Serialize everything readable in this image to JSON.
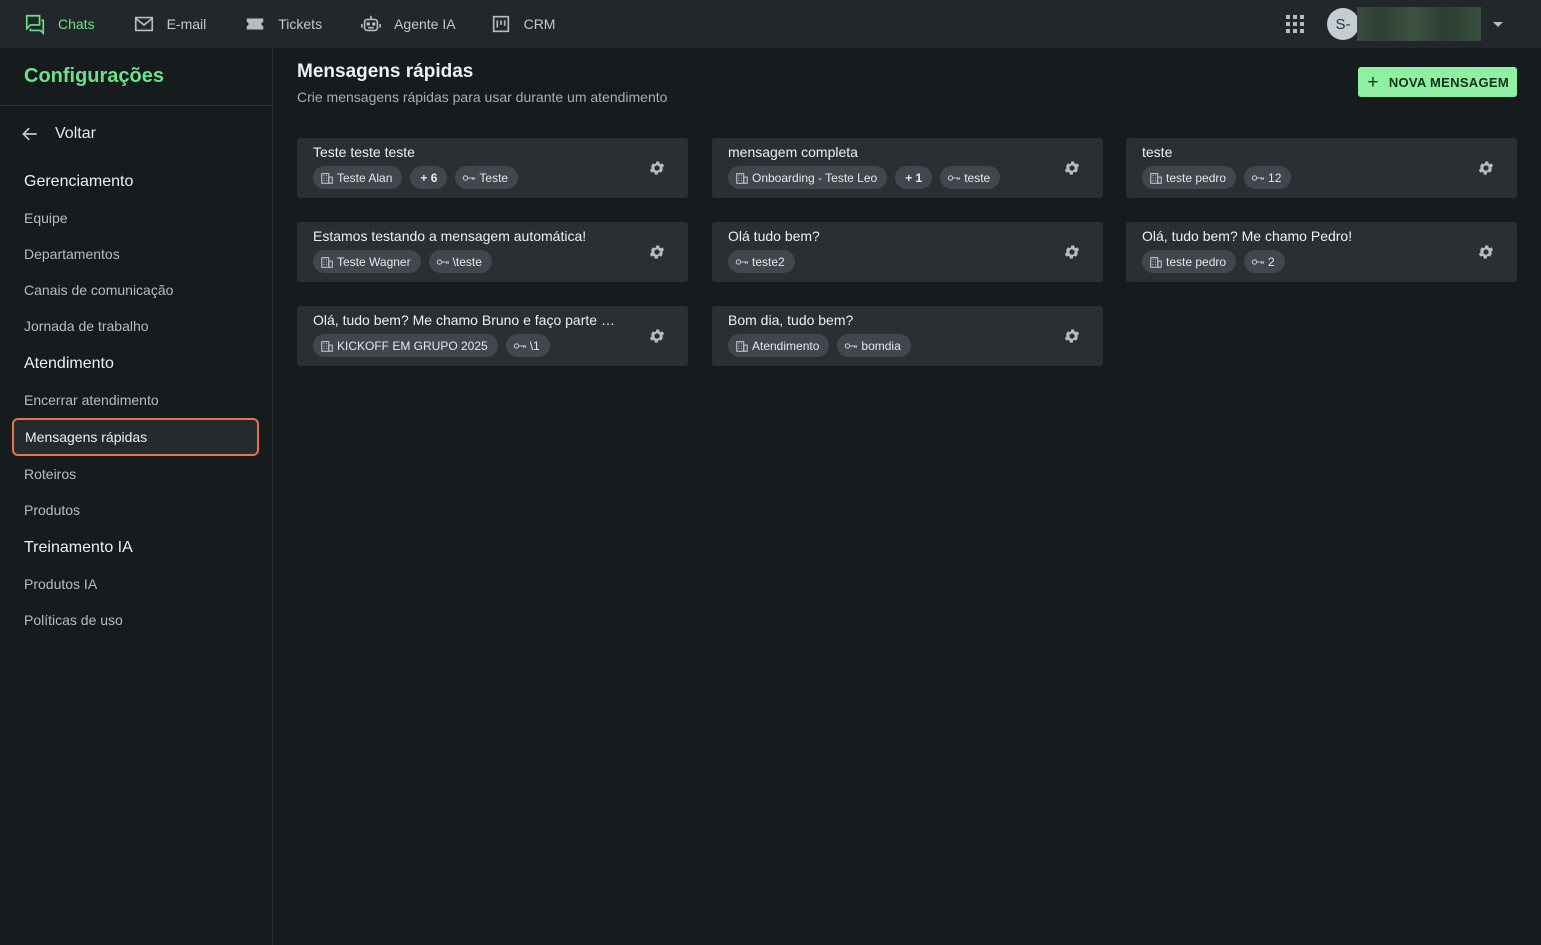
{
  "topnav": {
    "items": [
      {
        "label": "Chats",
        "icon": "chat-icon"
      },
      {
        "label": "E-mail",
        "icon": "mail-icon"
      },
      {
        "label": "Tickets",
        "icon": "ticket-icon"
      },
      {
        "label": "Agente IA",
        "icon": "robot-icon"
      },
      {
        "label": "CRM",
        "icon": "kanban-icon"
      }
    ],
    "avatar_initial": "S-"
  },
  "sidebar": {
    "title": "Configurações",
    "back_label": "Voltar",
    "sections": [
      {
        "title": "Gerenciamento",
        "items": [
          "Equipe",
          "Departamentos",
          "Canais de comunicação",
          "Jornada de trabalho"
        ]
      },
      {
        "title": "Atendimento",
        "items": [
          "Encerrar atendimento",
          "Mensagens rápidas",
          "Roteiros",
          "Produtos"
        ]
      },
      {
        "title": "Treinamento IA",
        "items": [
          "Produtos IA",
          "Políticas de uso"
        ]
      }
    ],
    "selected": "Mensagens rápidas"
  },
  "main": {
    "title": "Mensagens rápidas",
    "subtitle": "Crie mensagens rápidas para usar durante um atendimento",
    "new_button": "NOVA MENSAGEM",
    "cards": [
      {
        "title": "Teste teste teste",
        "department": "Teste Alan",
        "extra": "+ 6",
        "shortcut": "Teste"
      },
      {
        "title": "mensagem completa",
        "department": "Onboarding - Teste Leo",
        "extra": "+ 1",
        "shortcut": "teste"
      },
      {
        "title": "teste",
        "department": "teste pedro",
        "extra": "",
        "shortcut": "12"
      },
      {
        "title": "Estamos testando a mensagem automática!",
        "department": "Teste Wagner",
        "extra": "",
        "shortcut": "\\teste"
      },
      {
        "title": "Olá tudo bem?",
        "department": "",
        "extra": "",
        "shortcut": "teste2"
      },
      {
        "title": "Olá, tudo bem? Me chamo Pedro!",
        "department": "teste pedro",
        "extra": "",
        "shortcut": "2"
      },
      {
        "title": "Olá, tudo bem? Me chamo Bruno e faço parte da equipe",
        "department": "KICKOFF EM GRUPO 2025",
        "extra": "",
        "shortcut": "\\1"
      },
      {
        "title": "Bom dia, tudo bem?",
        "department": "Atendimento",
        "extra": "",
        "shortcut": "bomdia"
      }
    ]
  },
  "colors": {
    "accent": "#6fe08a",
    "button_bg": "#8ff0a4",
    "selected_border": "#e8734e",
    "card_bg": "#2a2f33"
  }
}
